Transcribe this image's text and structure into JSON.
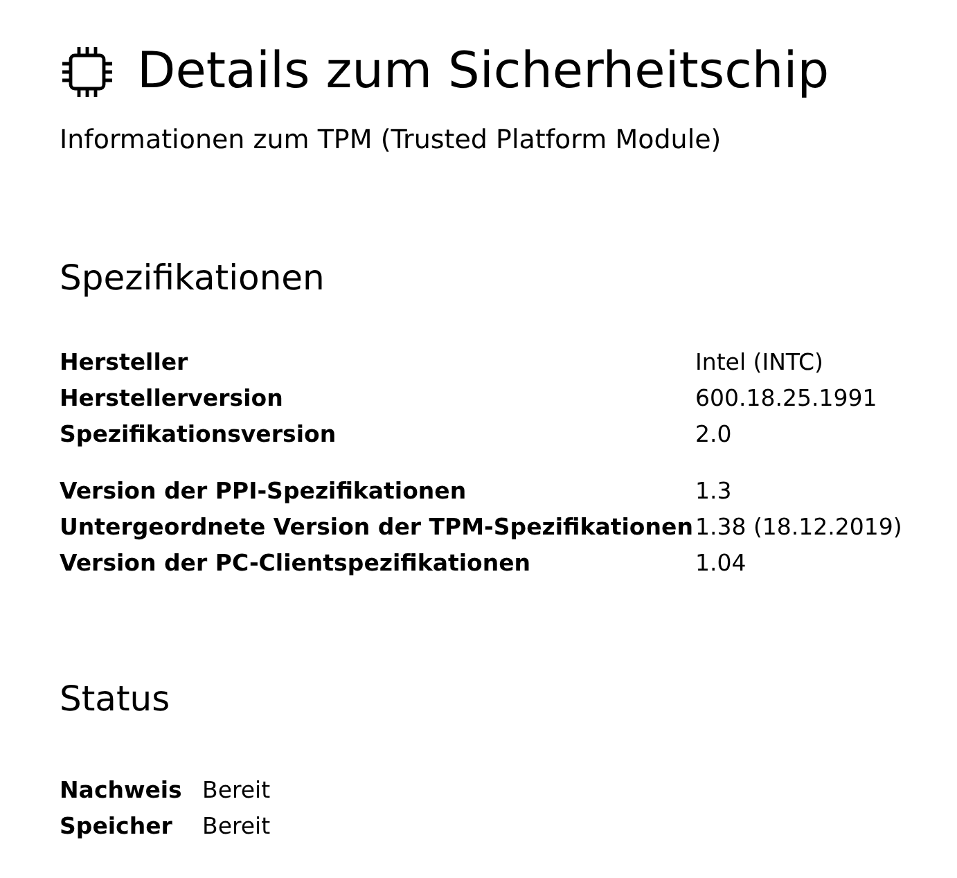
{
  "title": "Details zum Sicherheitschip",
  "subtitle": "Informationen zum TPM (Trusted Platform Module)",
  "sections": [
    {
      "heading": "Spezifikationen",
      "kind": "wide",
      "groups": [
        {
          "rows": [
            {
              "label": "Hersteller",
              "value": "Intel (INTC)"
            },
            {
              "label": "Herstellerversion",
              "value": "600.18.25.1991"
            },
            {
              "label": "Spezifikationsversion",
              "value": "2.0"
            }
          ]
        },
        {
          "rows": [
            {
              "label": "Version der PPI-Spezifikationen",
              "value": "1.3"
            },
            {
              "label": "Untergeordnete Version der TPM-Spezifikationen",
              "value": "1.38 (18.12.2019)"
            },
            {
              "label": "Version der PC-Clientspezifikationen",
              "value": "1.04"
            }
          ]
        }
      ]
    },
    {
      "heading": "Status",
      "kind": "narrow",
      "groups": [
        {
          "rows": [
            {
              "label": "Nachweis",
              "value": "Bereit"
            },
            {
              "label": "Speicher",
              "value": "Bereit"
            }
          ]
        }
      ]
    }
  ]
}
